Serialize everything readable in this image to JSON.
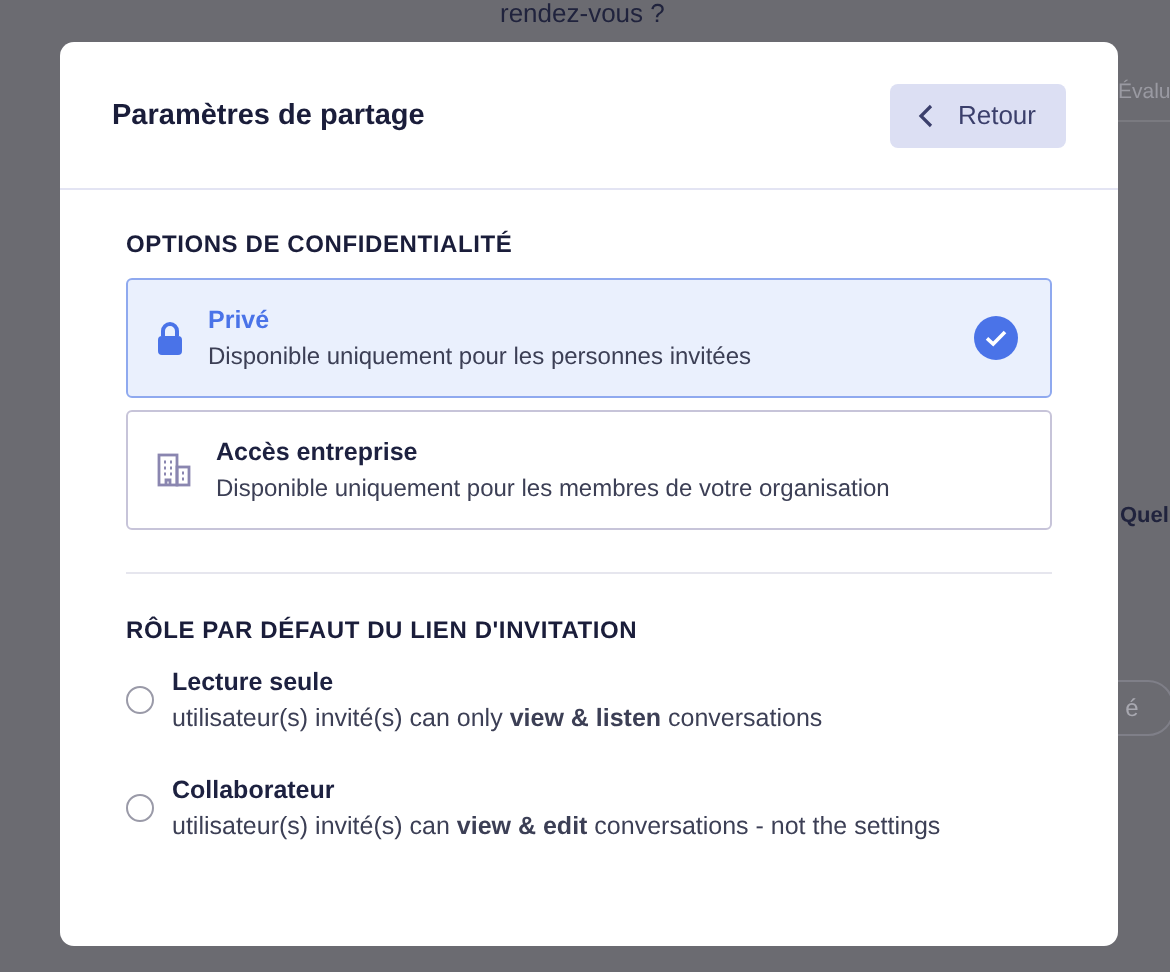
{
  "background": {
    "heading": "rendez-vous ?",
    "side_tab": "Évalu",
    "side_text": "Quel",
    "side_pill": "é"
  },
  "dialog": {
    "title": "Paramètres de partage",
    "back_button": "Retour"
  },
  "privacy": {
    "heading": "OPTIONS DE CONFIDENTIALITÉ",
    "options": [
      {
        "kind": "lock",
        "title": "Privé",
        "description": "Disponible uniquement pour les personnes invitées",
        "selected": true
      },
      {
        "kind": "building",
        "title": "Accès entreprise",
        "description": "Disponible uniquement pour les membres de votre organisation",
        "selected": false
      }
    ]
  },
  "role": {
    "heading": "RÔLE PAR DÉFAUT DU LIEN D'INVITATION",
    "options": [
      {
        "title": "Lecture seule",
        "description": "utilisateur(s) invité(s) can only **view & listen** conversations",
        "selected": false
      },
      {
        "title": "Collaborateur",
        "description": "utilisateur(s) invité(s) can **view & edit** conversations - not the settings",
        "selected": false
      }
    ]
  }
}
